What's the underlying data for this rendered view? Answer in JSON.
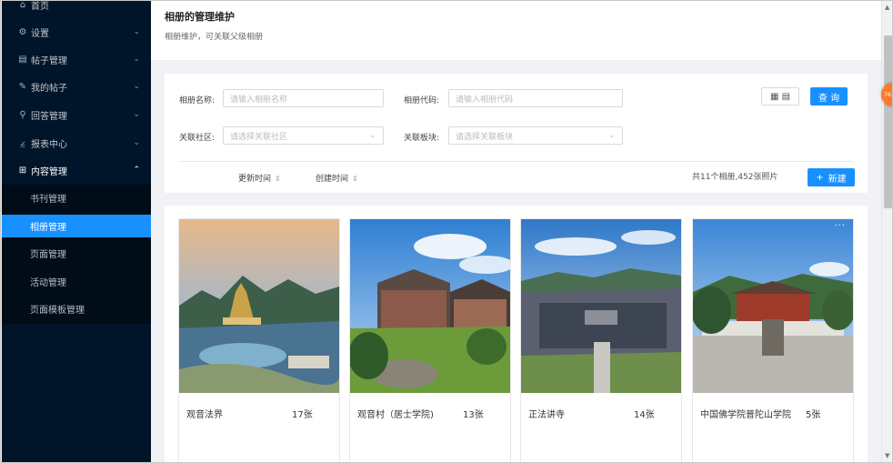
{
  "sidebar": {
    "items": [
      {
        "label": "首页",
        "icon": "home-icon"
      },
      {
        "label": "设置",
        "icon": "gear-icon"
      },
      {
        "label": "帖子管理",
        "icon": "post-icon"
      },
      {
        "label": "我的帖子",
        "icon": "edit-icon"
      },
      {
        "label": "回答管理",
        "icon": "pin-icon"
      },
      {
        "label": "报表中心",
        "icon": "chart-icon"
      },
      {
        "label": "内容管理",
        "icon": "grid-icon"
      }
    ],
    "subitems": [
      {
        "label": "书刊管理"
      },
      {
        "label": "相册管理",
        "active": true
      },
      {
        "label": "页面管理"
      },
      {
        "label": "活动管理"
      },
      {
        "label": "页面模板管理"
      }
    ]
  },
  "header": {
    "title": "相册的管理维护",
    "subtitle": "相册维护，可关联父级相册"
  },
  "filters": {
    "name_label": "相册名称:",
    "name_placeholder": "请输入相册名称",
    "code_label": "相册代码:",
    "code_placeholder": "请输入相册代码",
    "community_label": "关联社区:",
    "community_placeholder": "请选择关联社区",
    "block_label": "关联板块:",
    "block_placeholder": "请选择关联板块",
    "search_label": "查 询",
    "toggle_icon": "list-view-icon"
  },
  "toolbar": {
    "sort_updated": "更新时间",
    "sort_created": "创建时间",
    "count_text": "共11个相册,452张照片",
    "new_label": "新建"
  },
  "albums": [
    {
      "name": "观音法界",
      "count": "17张"
    },
    {
      "name": "观音村（居士学院)",
      "count": "13张"
    },
    {
      "name": "正法讲寺",
      "count": "14张"
    },
    {
      "name": "中国佛学院普陀山学院",
      "count": "5张"
    }
  ],
  "badge": "76",
  "colors": {
    "sidebar_bg": "#001529",
    "primary": "#1890ff",
    "badge": "#ff7a28"
  }
}
